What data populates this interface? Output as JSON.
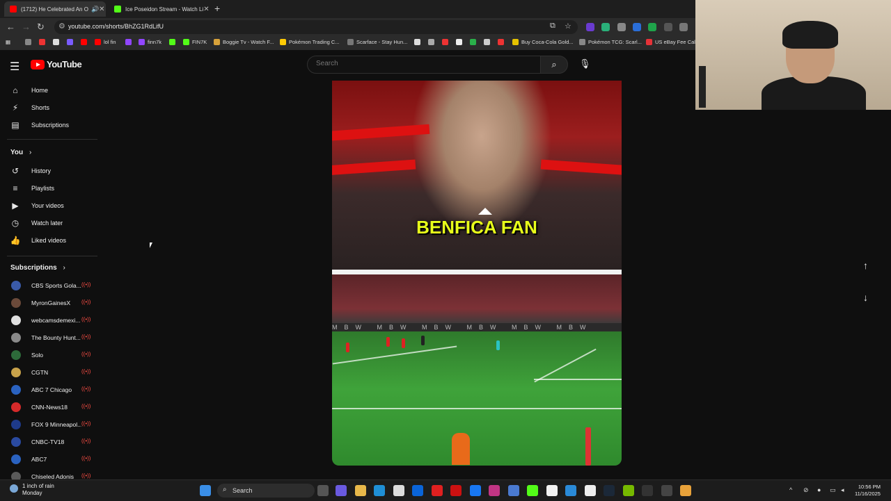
{
  "browser": {
    "tabs": [
      {
        "title": "(1712) He Celebrated An O",
        "favicon_color": "#ff0000",
        "active": true
      },
      {
        "title": "Ice Poseidon Stream - Watch Li",
        "favicon_color": "#53fc18",
        "active": false
      }
    ],
    "url": "youtube.com/shorts/BhZG1RdLifU",
    "bookmarks": [
      {
        "label": "lol fin",
        "color": "#ff0000"
      },
      {
        "label": "finn7k",
        "color": "#9146ff"
      },
      {
        "label": "FIN7K",
        "color": "#53fc18"
      },
      {
        "label": "Boggie Tv - Watch F...",
        "color": "#d8a23a"
      },
      {
        "label": "Pokémon Trading C...",
        "color": "#ffcb05"
      },
      {
        "label": "Scarface - Stay Hun...",
        "color": "#777777"
      },
      {
        "label": "Buy Coca-Cola Gold...",
        "color": "#e5c200"
      },
      {
        "label": "Pokémon TCG: Scarl...",
        "color": "#888888"
      },
      {
        "label": "US eBay Fee Calc",
        "color": "#e53238"
      }
    ]
  },
  "youtube": {
    "logo_text": "YouTube",
    "search_placeholder": "Search",
    "nav": [
      {
        "label": "Home",
        "icon": "⌂"
      },
      {
        "label": "Shorts",
        "icon": "⚡"
      },
      {
        "label": "Subscriptions",
        "icon": "▤"
      }
    ],
    "you_header": "You",
    "you_items": [
      {
        "label": "History",
        "icon": "↺"
      },
      {
        "label": "Playlists",
        "icon": "≡"
      },
      {
        "label": "Your videos",
        "icon": "▶"
      },
      {
        "label": "Watch later",
        "icon": "◷"
      },
      {
        "label": "Liked videos",
        "icon": "👍"
      }
    ],
    "subscriptions_header": "Subscriptions",
    "subscriptions": [
      {
        "name": "CBS Sports Gola...",
        "color": "#3a5aa8"
      },
      {
        "name": "MyronGainesX",
        "color": "#6b4a3a"
      },
      {
        "name": "webcamsdemexi...",
        "color": "#e0e0e0"
      },
      {
        "name": "The Bounty Hunt...",
        "color": "#8a8a8a"
      },
      {
        "name": "Solo",
        "color": "#2d6b3a"
      },
      {
        "name": "CGTN",
        "color": "#c8a24a"
      },
      {
        "name": "ABC 7 Chicago",
        "color": "#2a62c0"
      },
      {
        "name": "CNN-News18",
        "color": "#d62a2a"
      },
      {
        "name": "FOX 9 Minneapol...",
        "color": "#1e3a8a"
      },
      {
        "name": "CNBC-TV18",
        "color": "#2a4aa0"
      },
      {
        "name": "ABC7",
        "color": "#2a62c0"
      },
      {
        "name": "Chiseled Adonis",
        "color": "#5a5a5a"
      }
    ],
    "live_icon": "((•))",
    "short": {
      "caption": "BENFICA FAN",
      "board_text": "MBW MBW MBW MBW MBW MBW"
    }
  },
  "taskbar": {
    "weather_line1": "1 inch of rain",
    "weather_line2": "Monday",
    "search_label": "Search",
    "time": "10:56 PM",
    "date": "11/16/2025"
  }
}
